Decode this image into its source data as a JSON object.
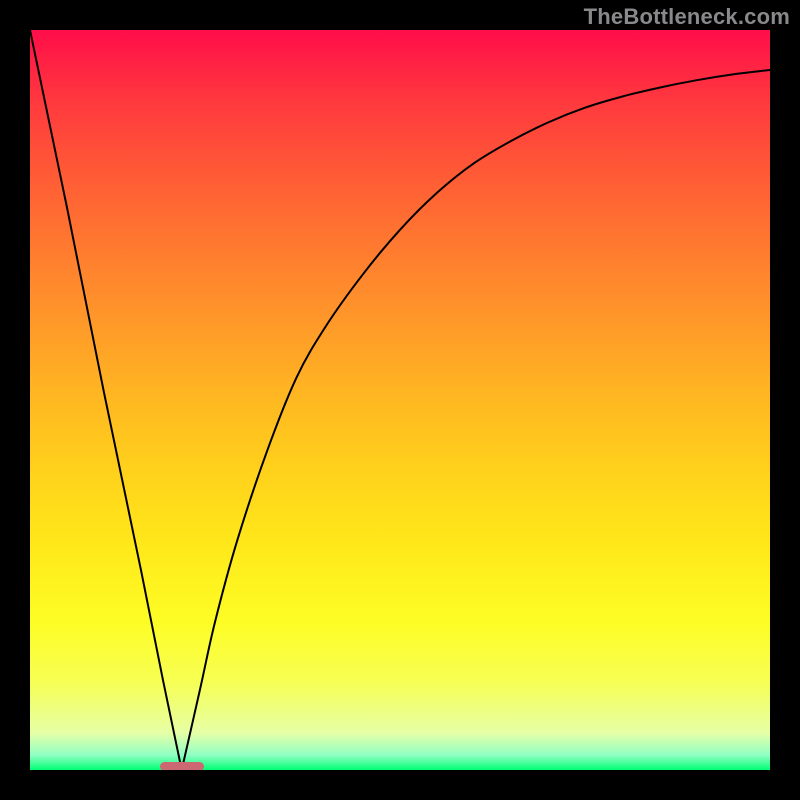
{
  "watermark": "TheBottleneck.com",
  "chart_data": {
    "type": "line",
    "title": "",
    "xlabel": "",
    "ylabel": "",
    "xlim": [
      0,
      100
    ],
    "ylim": [
      0,
      100
    ],
    "marker": {
      "x_start": 17.5,
      "x_end": 23.5
    },
    "series": [
      {
        "name": "bottleneck-curve",
        "x": [
          0,
          5,
          10,
          15,
          18,
          20.5,
          23,
          25,
          28,
          32,
          36,
          40,
          45,
          50,
          55,
          60,
          65,
          70,
          75,
          80,
          85,
          90,
          95,
          100
        ],
        "values": [
          100,
          76,
          51,
          27,
          12,
          0,
          11,
          20,
          31,
          43,
          53,
          60,
          67,
          73,
          78,
          82,
          85,
          87.5,
          89.5,
          91,
          92.2,
          93.2,
          94,
          94.6
        ]
      }
    ],
    "gradient_stops": [
      {
        "pos": 0,
        "color": "#ff0d4a"
      },
      {
        "pos": 10,
        "color": "#ff3a3e"
      },
      {
        "pos": 30,
        "color": "#ff7c2f"
      },
      {
        "pos": 50,
        "color": "#ffb821"
      },
      {
        "pos": 70,
        "color": "#ffe91a"
      },
      {
        "pos": 88,
        "color": "#f7ff53"
      },
      {
        "pos": 98,
        "color": "#8fffc4"
      },
      {
        "pos": 100,
        "color": "#00ff73"
      }
    ]
  }
}
